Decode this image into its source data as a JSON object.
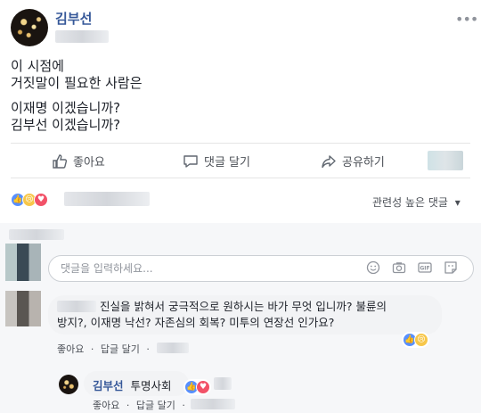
{
  "post": {
    "author": "김부선",
    "more_icon": "•••",
    "lines": [
      "이 시점에",
      "거짓말이 필요한 사람은",
      "이재명 이겠습니까?",
      "김부선 이겠습니까?"
    ]
  },
  "actions": {
    "like": "좋아요",
    "comment": "댓글 달기",
    "share": "공유하기"
  },
  "reactions": {
    "icons": [
      "like-icon",
      "sad-icon",
      "love-icon"
    ],
    "like_glyph": "👍",
    "sad_glyph": "😢",
    "love_glyph": "♥"
  },
  "sort": {
    "label": "관련성 높은 댓글",
    "caret": "▾"
  },
  "comment_input": {
    "placeholder": "댓글을 입력하세요..."
  },
  "comment": {
    "text_line1": "진실을 밝혀서 궁극적으로 원하시는 바가 무엇 입니까? 불륜의",
    "text_line2": "방지?, 이재명 낙선? 자존심의 회복? 미투의 연장선 인가요?",
    "like": "좋아요",
    "reply": "답글 달기"
  },
  "reply": {
    "author": "김부선",
    "text": "투명사회",
    "like": "좋아요",
    "reply": "답글 달기"
  },
  "colors": {
    "link": "#365899",
    "like_blue": "#5890ff",
    "love_red": "#f25268",
    "sad_yellow": "#f7c74a"
  }
}
